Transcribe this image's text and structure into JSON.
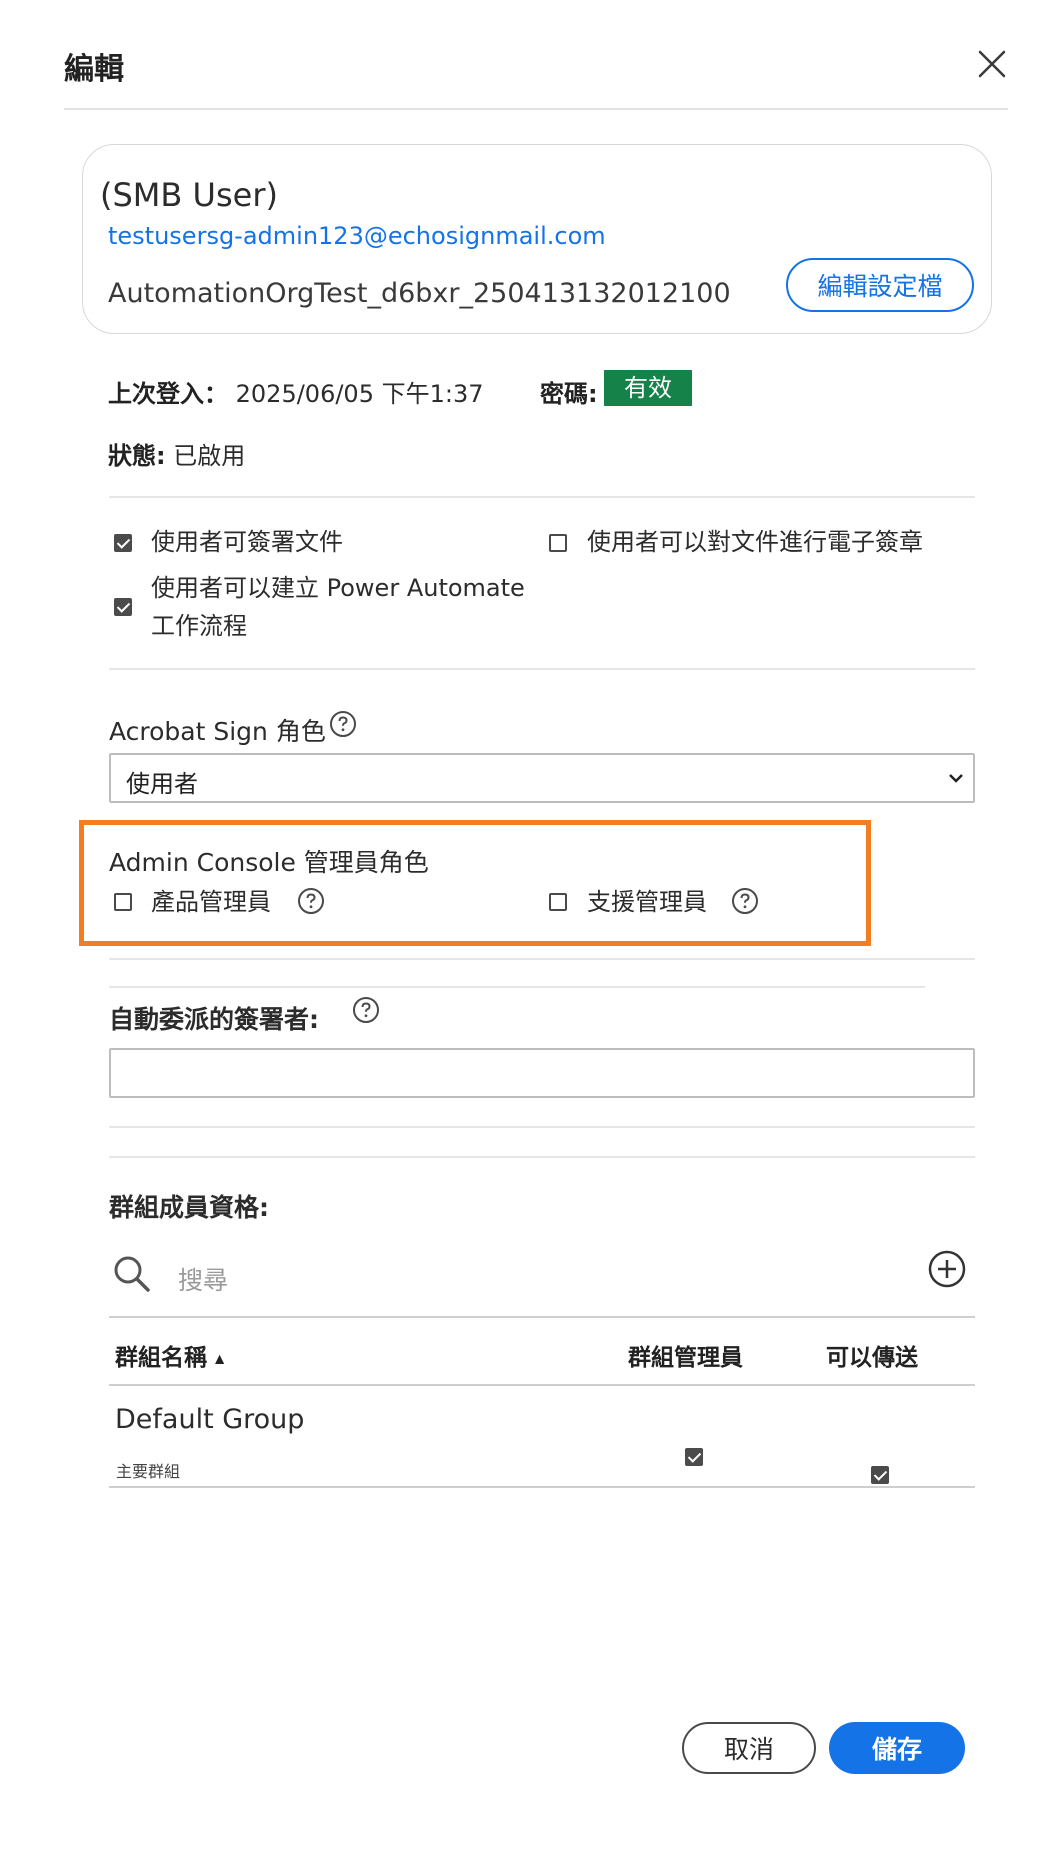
{
  "dialog": {
    "title": "編輯",
    "close_icon": "close-icon"
  },
  "profile": {
    "name": "(SMB User)",
    "email": "testusersg-admin123@echosignmail.com",
    "org": "AutomationOrgTest_d6bxr_250413132012100",
    "edit_profile_label": "編輯設定檔"
  },
  "meta": {
    "last_login_label": "上次登入：",
    "last_login_value": "2025/06/05 下午1:37",
    "password_label": "密碼:",
    "password_status": "有效",
    "password_status_color": "#15824a",
    "status_label": "狀態:",
    "status_value": "已啟用"
  },
  "permissions": [
    {
      "label": "使用者可簽署文件",
      "checked": true
    },
    {
      "label": "使用者可以對文件進行電子簽章",
      "checked": false
    },
    {
      "label": "使用者可以建立 Power Automate",
      "label2": "工作流程",
      "checked": true
    }
  ],
  "sign_role": {
    "label": "Acrobat Sign 角色",
    "selected": "使用者"
  },
  "admin_console": {
    "label": "Admin Console 管理員角色",
    "roles": [
      {
        "label": "產品管理員",
        "checked": false
      },
      {
        "label": "支援管理員",
        "checked": false
      }
    ],
    "highlight_color": "#f47d20"
  },
  "auto_delegate": {
    "label": "自動委派的簽署者:",
    "value": ""
  },
  "groups": {
    "label": "群組成員資格:",
    "search_placeholder": "搜尋",
    "columns": {
      "name": "群組名稱",
      "admin": "群組管理員",
      "can_send": "可以傳送"
    },
    "rows": [
      {
        "name": "Default Group",
        "sub": "主要群組",
        "admin": true,
        "can_send": true
      }
    ]
  },
  "footer": {
    "cancel_label": "取消",
    "save_label": "儲存",
    "accent_color": "#1473e6"
  }
}
